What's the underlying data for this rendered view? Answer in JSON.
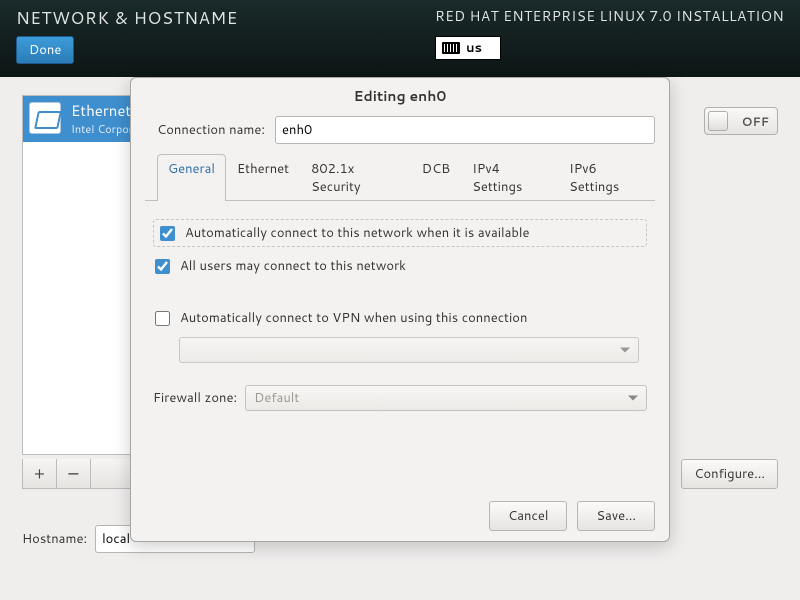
{
  "topbar": {
    "title": "NETWORK & HOSTNAME",
    "subtitle": "RED HAT ENTERPRISE LINUX 7.0 INSTALLATION",
    "done_label": "Done",
    "keyboard_layout": "us"
  },
  "netpage": {
    "nic": {
      "name": "Ethernet",
      "sub": "Intel Corporati…"
    },
    "add_label": "+",
    "remove_label": "−",
    "toggle_label": "OFF",
    "configure_label": "Configure...",
    "hostname_label": "Hostname:",
    "hostname_value": "local"
  },
  "dialog": {
    "title": "Editing enh0",
    "conn_name_label": "Connection name:",
    "conn_name_value": "enh0",
    "tabs": [
      "General",
      "Ethernet",
      "802.1x Security",
      "DCB",
      "IPv4 Settings",
      "IPv6 Settings"
    ],
    "general": {
      "auto_connect": "Automatically connect to this network when it is available",
      "all_users": "All users may connect to this network",
      "auto_vpn": "Automatically connect to VPN when using this connection",
      "firewall_label": "Firewall zone:",
      "firewall_value": "Default"
    },
    "cancel_label": "Cancel",
    "save_label": "Save..."
  }
}
